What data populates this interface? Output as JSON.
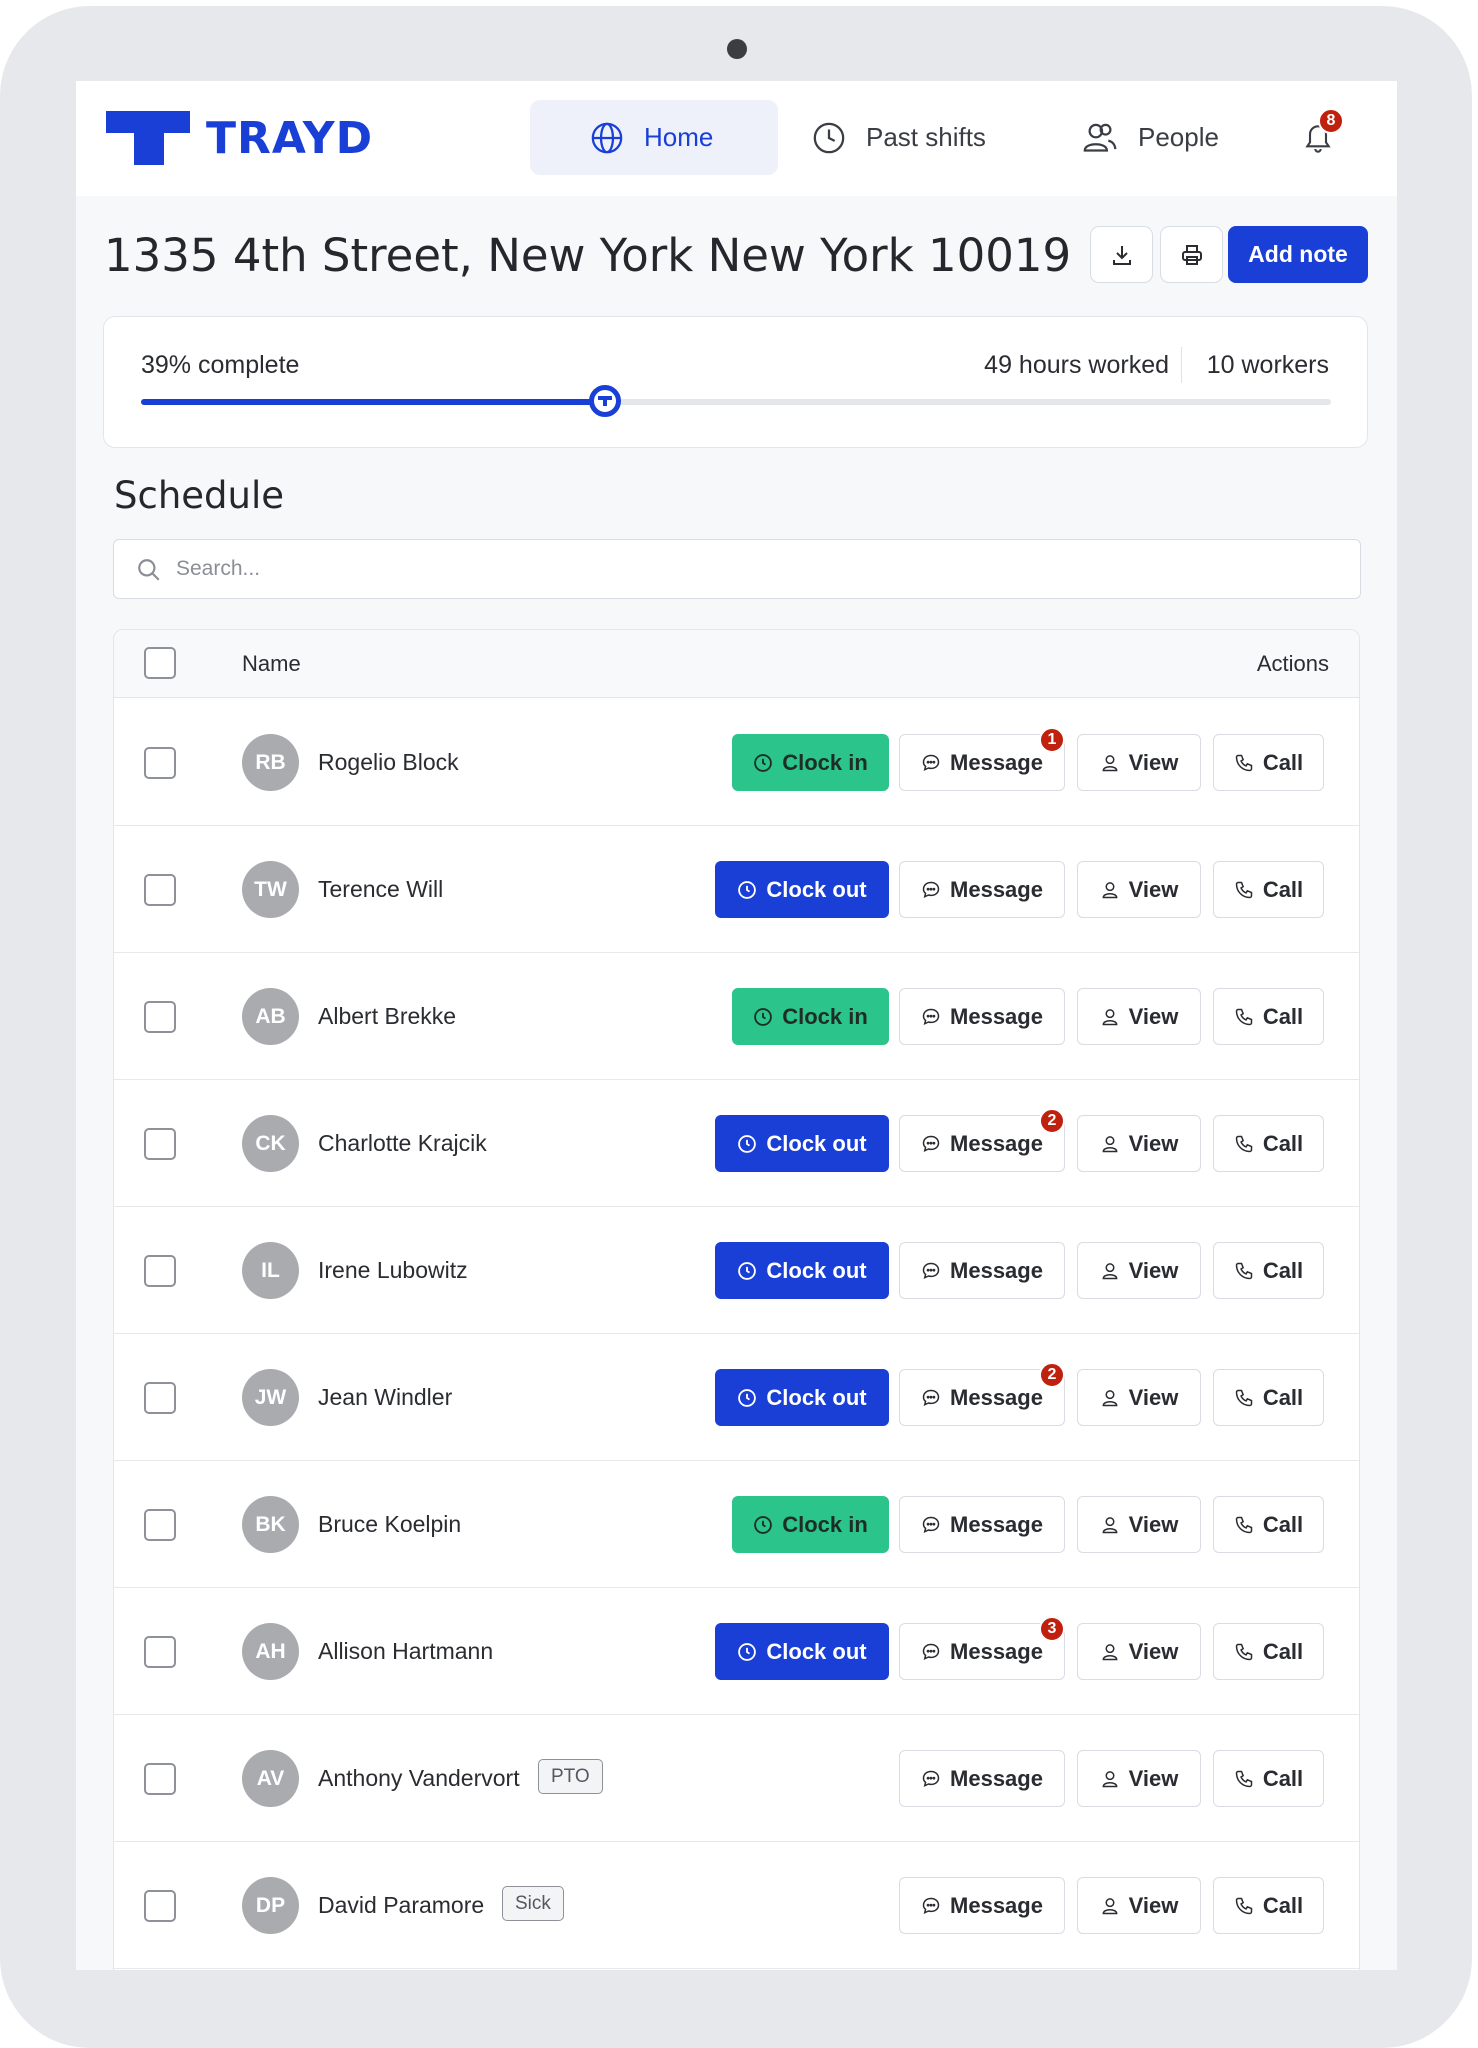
{
  "app": {
    "brand": "TRAYD",
    "brand_color": "#1a3fd6"
  },
  "nav": {
    "home": "Home",
    "past_shifts": "Past shifts",
    "people": "People",
    "notifications_count": "8"
  },
  "header": {
    "title": "1335 4th Street, New York New York 10019",
    "add_note": "Add note"
  },
  "progress": {
    "label": "39% complete",
    "percent": 39,
    "hours": "49 hours worked",
    "workers": "10 workers"
  },
  "schedule": {
    "title": "Schedule",
    "search_placeholder": "Search...",
    "col_name": "Name",
    "col_actions": "Actions",
    "rows": [
      {
        "initials": "RB",
        "name": "Rogelio Block",
        "tag": "",
        "clock": "Clock in",
        "msg_badge": "1"
      },
      {
        "initials": "TW",
        "name": "Terence Will",
        "tag": "",
        "clock": "Clock out",
        "msg_badge": ""
      },
      {
        "initials": "AB",
        "name": "Albert Brekke",
        "tag": "",
        "clock": "Clock in",
        "msg_badge": ""
      },
      {
        "initials": "CK",
        "name": "Charlotte Krajcik",
        "tag": "",
        "clock": "Clock out",
        "msg_badge": "2"
      },
      {
        "initials": "IL",
        "name": "Irene Lubowitz",
        "tag": "",
        "clock": "Clock out",
        "msg_badge": ""
      },
      {
        "initials": "JW",
        "name": "Jean Windler",
        "tag": "",
        "clock": "Clock out",
        "msg_badge": "2"
      },
      {
        "initials": "BK",
        "name": "Bruce Koelpin",
        "tag": "",
        "clock": "Clock in",
        "msg_badge": ""
      },
      {
        "initials": "AH",
        "name": "Allison Hartmann",
        "tag": "",
        "clock": "Clock out",
        "msg_badge": "3"
      },
      {
        "initials": "AV",
        "name": "Anthony Vandervort",
        "tag": "PTO",
        "clock": "",
        "msg_badge": ""
      },
      {
        "initials": "DP",
        "name": "David Paramore",
        "tag": "Sick",
        "clock": "",
        "msg_badge": ""
      }
    ],
    "actions": {
      "message": "Message",
      "view": "View",
      "call": "Call"
    }
  }
}
